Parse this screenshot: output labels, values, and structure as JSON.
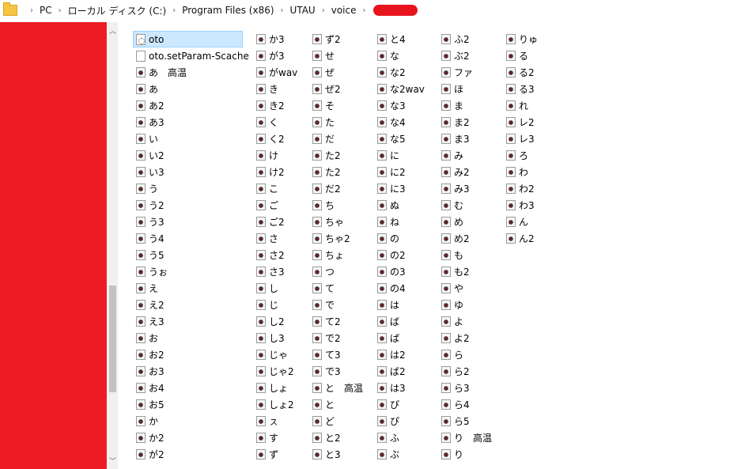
{
  "breadcrumb": {
    "items": [
      "PC",
      "ローカル ディスク (C:)",
      "Program Files (x86)",
      "UTAU",
      "voice"
    ],
    "separator": "›"
  },
  "colors": {
    "redaction": "#ed1c24",
    "selection": "#cce8ff"
  },
  "files": {
    "columns": [
      [
        {
          "name": "oto",
          "icon": "settings-file-icon",
          "selected": true
        },
        {
          "name": "oto.setParam-Scache",
          "icon": "file-icon"
        },
        {
          "name": "あ　高温",
          "icon": "wav-icon"
        },
        {
          "name": "あ",
          "icon": "wav-icon"
        },
        {
          "name": "あ2",
          "icon": "wav-icon"
        },
        {
          "name": "あ3",
          "icon": "wav-icon"
        },
        {
          "name": "い",
          "icon": "wav-icon"
        },
        {
          "name": "い2",
          "icon": "wav-icon"
        },
        {
          "name": "い3",
          "icon": "wav-icon"
        },
        {
          "name": "う",
          "icon": "wav-icon"
        },
        {
          "name": "う2",
          "icon": "wav-icon"
        },
        {
          "name": "う3",
          "icon": "wav-icon"
        },
        {
          "name": "う4",
          "icon": "wav-icon"
        },
        {
          "name": "う5",
          "icon": "wav-icon"
        },
        {
          "name": "うぉ",
          "icon": "wav-icon"
        },
        {
          "name": "え",
          "icon": "wav-icon"
        },
        {
          "name": "え2",
          "icon": "wav-icon"
        },
        {
          "name": "え3",
          "icon": "wav-icon"
        },
        {
          "name": "お",
          "icon": "wav-icon"
        },
        {
          "name": "お2",
          "icon": "wav-icon"
        },
        {
          "name": "お3",
          "icon": "wav-icon"
        },
        {
          "name": "お4",
          "icon": "wav-icon"
        },
        {
          "name": "お5",
          "icon": "wav-icon"
        },
        {
          "name": "か",
          "icon": "wav-icon"
        },
        {
          "name": "か2",
          "icon": "wav-icon"
        },
        {
          "name": "が2",
          "icon": "wav-icon"
        }
      ],
      [
        {
          "name": "か3",
          "icon": "wav-icon"
        },
        {
          "name": "が3",
          "icon": "wav-icon"
        },
        {
          "name": "がwav",
          "icon": "wav-icon"
        },
        {
          "name": "き",
          "icon": "wav-icon"
        },
        {
          "name": "き2",
          "icon": "wav-icon"
        },
        {
          "name": "く",
          "icon": "wav-icon"
        },
        {
          "name": "く2",
          "icon": "wav-icon"
        },
        {
          "name": "け",
          "icon": "wav-icon"
        },
        {
          "name": "け2",
          "icon": "wav-icon"
        },
        {
          "name": "こ",
          "icon": "wav-icon"
        },
        {
          "name": "ご",
          "icon": "wav-icon"
        },
        {
          "name": "ご2",
          "icon": "wav-icon"
        },
        {
          "name": "さ",
          "icon": "wav-icon"
        },
        {
          "name": "さ2",
          "icon": "wav-icon"
        },
        {
          "name": "さ3",
          "icon": "wav-icon"
        },
        {
          "name": "し",
          "icon": "wav-icon"
        },
        {
          "name": "じ",
          "icon": "wav-icon"
        },
        {
          "name": "し2",
          "icon": "wav-icon"
        },
        {
          "name": "し3",
          "icon": "wav-icon"
        },
        {
          "name": "じゃ",
          "icon": "wav-icon"
        },
        {
          "name": "じゃ2",
          "icon": "wav-icon"
        },
        {
          "name": "しょ",
          "icon": "wav-icon"
        },
        {
          "name": "しょ2",
          "icon": "wav-icon"
        },
        {
          "name": "ㇲ",
          "icon": "wav-icon"
        },
        {
          "name": "す",
          "icon": "wav-icon"
        },
        {
          "name": "ず",
          "icon": "wav-icon"
        }
      ],
      [
        {
          "name": "ず2",
          "icon": "wav-icon"
        },
        {
          "name": "せ",
          "icon": "wav-icon"
        },
        {
          "name": "ぜ",
          "icon": "wav-icon"
        },
        {
          "name": "ぜ2",
          "icon": "wav-icon"
        },
        {
          "name": "そ",
          "icon": "wav-icon"
        },
        {
          "name": "た",
          "icon": "wav-icon"
        },
        {
          "name": "だ",
          "icon": "wav-icon"
        },
        {
          "name": "た2",
          "icon": "wav-icon"
        },
        {
          "name": "た2",
          "icon": "wav-icon"
        },
        {
          "name": "だ2",
          "icon": "wav-icon"
        },
        {
          "name": "ち",
          "icon": "wav-icon"
        },
        {
          "name": "ちゃ",
          "icon": "wav-icon"
        },
        {
          "name": "ちゃ2",
          "icon": "wav-icon"
        },
        {
          "name": "ちょ",
          "icon": "wav-icon"
        },
        {
          "name": "つ",
          "icon": "wav-icon"
        },
        {
          "name": "て",
          "icon": "wav-icon"
        },
        {
          "name": "で",
          "icon": "wav-icon"
        },
        {
          "name": "て2",
          "icon": "wav-icon"
        },
        {
          "name": "で2",
          "icon": "wav-icon"
        },
        {
          "name": "て3",
          "icon": "wav-icon"
        },
        {
          "name": "で3",
          "icon": "wav-icon"
        },
        {
          "name": "と　高温",
          "icon": "wav-icon"
        },
        {
          "name": "と",
          "icon": "wav-icon"
        },
        {
          "name": "ど",
          "icon": "wav-icon"
        },
        {
          "name": "と2",
          "icon": "wav-icon"
        },
        {
          "name": "と3",
          "icon": "wav-icon"
        }
      ],
      [
        {
          "name": "と4",
          "icon": "wav-icon"
        },
        {
          "name": "な",
          "icon": "wav-icon"
        },
        {
          "name": "な2",
          "icon": "wav-icon"
        },
        {
          "name": "な2wav",
          "icon": "wav-icon"
        },
        {
          "name": "な3",
          "icon": "wav-icon"
        },
        {
          "name": "な4",
          "icon": "wav-icon"
        },
        {
          "name": "な5",
          "icon": "wav-icon"
        },
        {
          "name": "に",
          "icon": "wav-icon"
        },
        {
          "name": "に2",
          "icon": "wav-icon"
        },
        {
          "name": "に3",
          "icon": "wav-icon"
        },
        {
          "name": "ぬ",
          "icon": "wav-icon"
        },
        {
          "name": "ね",
          "icon": "wav-icon"
        },
        {
          "name": "の",
          "icon": "wav-icon"
        },
        {
          "name": "の2",
          "icon": "wav-icon"
        },
        {
          "name": "の3",
          "icon": "wav-icon"
        },
        {
          "name": "の4",
          "icon": "wav-icon"
        },
        {
          "name": "は",
          "icon": "wav-icon"
        },
        {
          "name": "ば",
          "icon": "wav-icon"
        },
        {
          "name": "ぱ",
          "icon": "wav-icon"
        },
        {
          "name": "は2",
          "icon": "wav-icon"
        },
        {
          "name": "ば2",
          "icon": "wav-icon"
        },
        {
          "name": "は3",
          "icon": "wav-icon"
        },
        {
          "name": "ぴ",
          "icon": "wav-icon"
        },
        {
          "name": "ぴ",
          "icon": "wav-icon"
        },
        {
          "name": "ふ",
          "icon": "wav-icon"
        },
        {
          "name": "ぶ",
          "icon": "wav-icon"
        }
      ],
      [
        {
          "name": "ふ2",
          "icon": "wav-icon"
        },
        {
          "name": "ぶ2",
          "icon": "wav-icon"
        },
        {
          "name": "ファ",
          "icon": "wav-icon"
        },
        {
          "name": "ほ",
          "icon": "wav-icon"
        },
        {
          "name": "ま",
          "icon": "wav-icon"
        },
        {
          "name": "ま2",
          "icon": "wav-icon"
        },
        {
          "name": "ま3",
          "icon": "wav-icon"
        },
        {
          "name": "み",
          "icon": "wav-icon"
        },
        {
          "name": "み2",
          "icon": "wav-icon"
        },
        {
          "name": "み3",
          "icon": "wav-icon"
        },
        {
          "name": "む",
          "icon": "wav-icon"
        },
        {
          "name": "め",
          "icon": "wav-icon"
        },
        {
          "name": "め2",
          "icon": "wav-icon"
        },
        {
          "name": "も",
          "icon": "wav-icon"
        },
        {
          "name": "も2",
          "icon": "wav-icon"
        },
        {
          "name": "や",
          "icon": "wav-icon"
        },
        {
          "name": "ゆ",
          "icon": "wav-icon"
        },
        {
          "name": "よ",
          "icon": "wav-icon"
        },
        {
          "name": "よ2",
          "icon": "wav-icon"
        },
        {
          "name": "ら",
          "icon": "wav-icon"
        },
        {
          "name": "ら2",
          "icon": "wav-icon"
        },
        {
          "name": "ら3",
          "icon": "wav-icon"
        },
        {
          "name": "ら4",
          "icon": "wav-icon"
        },
        {
          "name": "ら5",
          "icon": "wav-icon"
        },
        {
          "name": "り　高温",
          "icon": "wav-icon"
        },
        {
          "name": "り",
          "icon": "wav-icon"
        }
      ],
      [
        {
          "name": "りゅ",
          "icon": "wav-icon"
        },
        {
          "name": "る",
          "icon": "wav-icon"
        },
        {
          "name": "る2",
          "icon": "wav-icon"
        },
        {
          "name": "る3",
          "icon": "wav-icon"
        },
        {
          "name": "れ",
          "icon": "wav-icon"
        },
        {
          "name": "レ2",
          "icon": "wav-icon"
        },
        {
          "name": "レ3",
          "icon": "wav-icon"
        },
        {
          "name": "ろ",
          "icon": "wav-icon"
        },
        {
          "name": "わ",
          "icon": "wav-icon"
        },
        {
          "name": "わ2",
          "icon": "wav-icon"
        },
        {
          "name": "わ3",
          "icon": "wav-icon"
        },
        {
          "name": "ん",
          "icon": "wav-icon"
        },
        {
          "name": "ん2",
          "icon": "wav-icon"
        }
      ]
    ]
  }
}
